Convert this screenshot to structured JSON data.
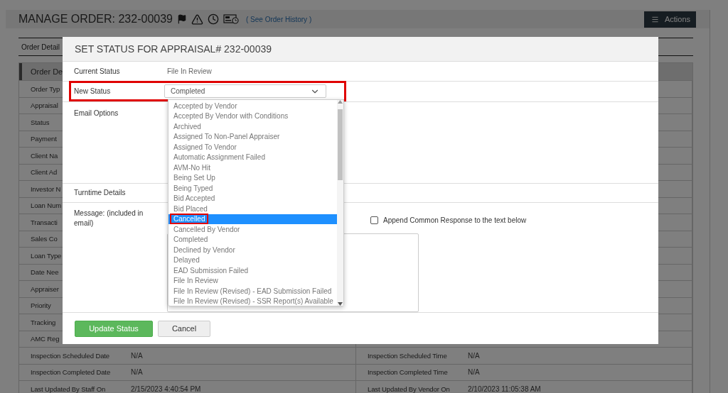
{
  "page": {
    "title": "MANAGE ORDER: 232-00039",
    "history_link": "( See Order History )",
    "actions_button": "Actions",
    "tabs": [
      {
        "label": "Order Detail",
        "selected": true
      }
    ],
    "section_heading": "Order De",
    "rows": [
      {
        "label": "Order Typ"
      },
      {
        "label": "Appraisal"
      },
      {
        "label": "Status"
      },
      {
        "label": "Payment"
      },
      {
        "label": "Client Na"
      },
      {
        "label": "Client Ad"
      },
      {
        "label": "Investor N"
      },
      {
        "label": "Loan Num"
      },
      {
        "label": "Transacti"
      },
      {
        "label": "Sales Co"
      },
      {
        "label": "Loan Type"
      },
      {
        "label": "Date Nee"
      },
      {
        "label": "Appraiser"
      },
      {
        "label": "Priority"
      },
      {
        "label": "Tracking"
      },
      {
        "label": "AMC Reg"
      },
      {
        "label": "Inspection Scheduled Date",
        "value": "N/A",
        "label_2": "Inspection Scheduled Time",
        "value_2": "N/A"
      },
      {
        "label": "Inspection Completed Date",
        "value": "N/A",
        "label_2": "Inspection Completed Time",
        "value_2": "N/A"
      },
      {
        "label": "Last Updated By Staff On",
        "value": "2/15/2023 4:40:54 PM",
        "label_2": "Last Updated By Vendor On",
        "value_2": "2/10/2023 11:05:38 AM"
      }
    ]
  },
  "dialog": {
    "title": "SET STATUS FOR APPRAISAL# 232-00039",
    "fields": [
      {
        "kind": "text",
        "label": "Current Status",
        "value": "File In Review"
      },
      {
        "kind": "select",
        "label": "New Status",
        "value": "Completed",
        "highlighted": true
      },
      {
        "kind": "blank",
        "label": "Email Options"
      },
      {
        "kind": "blank",
        "label": "Turntime Details"
      },
      {
        "kind": "message",
        "label": "Message: (included in email)",
        "checkbox": {
          "label": "Append Common Response to the text below",
          "checked": false
        }
      }
    ],
    "dropdown": {
      "options": [
        {
          "label": "Accepted by Vendor",
          "selected": false,
          "highlighted": false
        },
        {
          "label": "Accepted By Vendor with Conditions",
          "selected": false,
          "highlighted": false
        },
        {
          "label": "Archived",
          "selected": false,
          "highlighted": false
        },
        {
          "label": "Assigned To Non-Panel Appraiser",
          "selected": false,
          "highlighted": false
        },
        {
          "label": "Assigned To Vendor",
          "selected": false,
          "highlighted": false
        },
        {
          "label": "Automatic Assignment Failed",
          "selected": false,
          "highlighted": false
        },
        {
          "label": "AVM-No Hit",
          "selected": false,
          "highlighted": false
        },
        {
          "label": "Being Set Up",
          "selected": false,
          "highlighted": false
        },
        {
          "label": "Being Typed",
          "selected": false,
          "highlighted": false
        },
        {
          "label": "Bid Accepted",
          "selected": false,
          "highlighted": false
        },
        {
          "label": "Bid Placed",
          "selected": false,
          "highlighted": false
        },
        {
          "label": "Cancelled",
          "selected": true,
          "highlighted": true
        },
        {
          "label": "Cancelled By Vendor",
          "selected": false,
          "highlighted": false
        },
        {
          "label": "Completed",
          "selected": false,
          "highlighted": false
        },
        {
          "label": "Declined by Vendor",
          "selected": false,
          "highlighted": false
        },
        {
          "label": "Delayed",
          "selected": false,
          "highlighted": false
        },
        {
          "label": "EAD Submission Failed",
          "selected": false,
          "highlighted": false
        },
        {
          "label": "File In Review",
          "selected": false,
          "highlighted": false
        },
        {
          "label": "File In Review (Revised) - EAD Submission Failed",
          "selected": false,
          "highlighted": false
        },
        {
          "label": "File In Review (Revised) - SSR Report(s) Available",
          "selected": false,
          "highlighted": false
        }
      ]
    },
    "buttons": [
      {
        "label": "Update Status",
        "kind": "primary"
      },
      {
        "label": "Cancel",
        "kind": "secondary"
      }
    ]
  }
}
